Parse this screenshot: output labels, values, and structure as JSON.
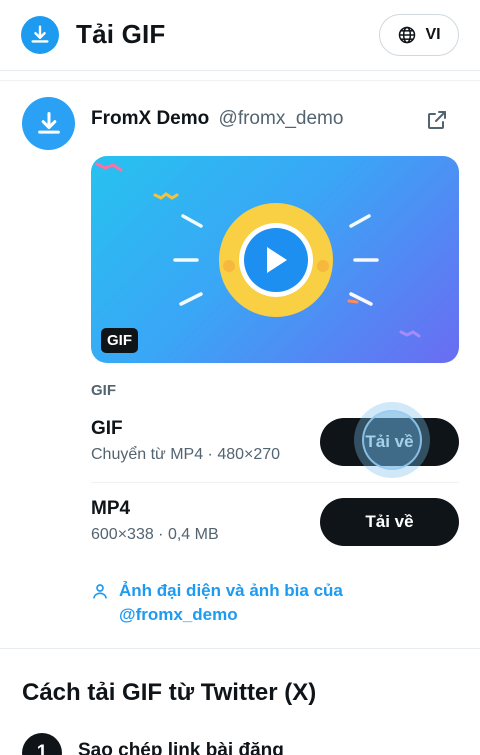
{
  "header": {
    "title": "Tải GIF",
    "lang_code": "VI"
  },
  "tweet": {
    "author_name": "FromX Demo",
    "author_handle": "@fromx_demo",
    "media_badge": "GIF"
  },
  "formats_section_label": "GIF",
  "formats": [
    {
      "name": "GIF",
      "meta": "Chuyển từ MP4 · 480×270",
      "button_label": "Tải về"
    },
    {
      "name": "MP4",
      "meta": "600×338 · 0,4 MB",
      "button_label": "Tải về"
    }
  ],
  "profile_link": "Ảnh đại diện và ảnh bìa của @fromx_demo",
  "howto": {
    "title": "Cách tải GIF từ Twitter (X)",
    "steps": [
      {
        "num": "1",
        "text": "Sao chép link bài đăng"
      }
    ]
  },
  "colors": {
    "accent": "#1d9bf0",
    "button_dark": "#0f1419",
    "media_gradient_start": "#27c2ef",
    "media_gradient_end": "#6a6cf2",
    "play_circle": "#f9cf43"
  },
  "icons": {
    "app_logo": "download-icon",
    "lang": "globe-icon",
    "open": "external-link-icon",
    "profile": "user-icon",
    "play": "play-icon"
  }
}
